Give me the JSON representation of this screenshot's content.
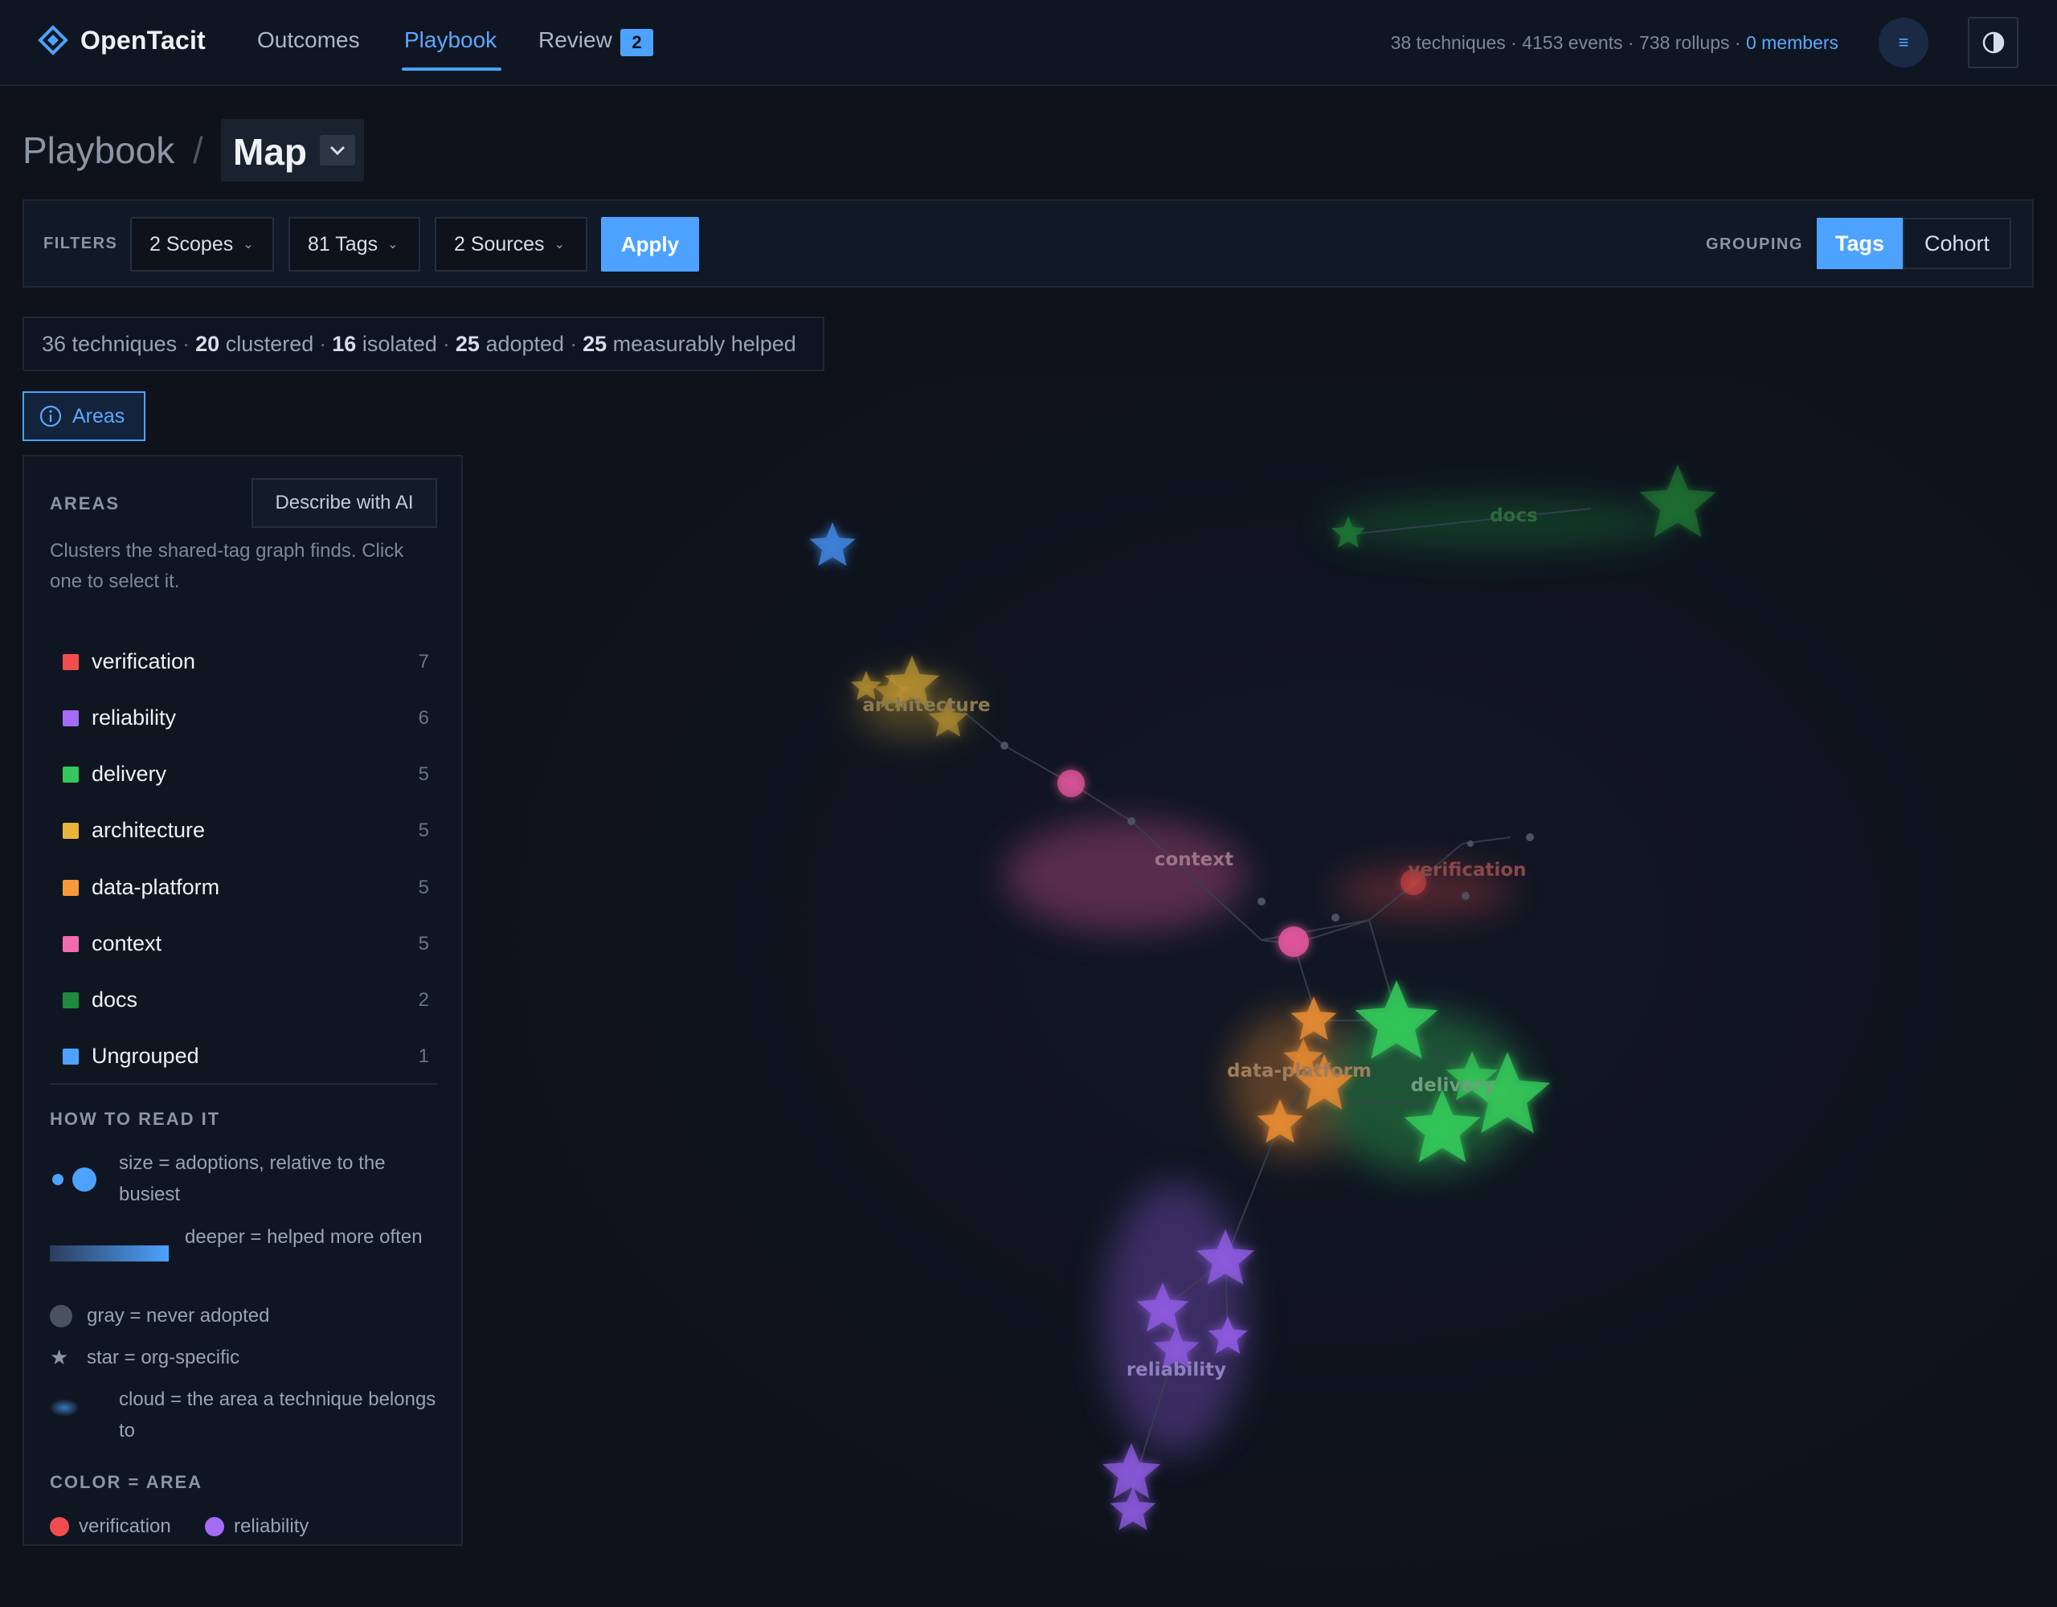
{
  "brand": {
    "name": "OpenTacit",
    "icon": "diamond-logo-icon"
  },
  "nav": {
    "outcomes": "Outcomes",
    "playbook": "Playbook",
    "review": "Review",
    "review_badge": "2"
  },
  "top_stats": {
    "summary": "38 techniques · 4153 events · 738 rollups · ",
    "members_link": "0 members",
    "menu_icon": "≡",
    "theme_icon": "contrast-icon"
  },
  "breadcrumb": {
    "root": "Playbook",
    "separator": "/",
    "current": "Map"
  },
  "filters": {
    "label": "FILTERS",
    "scopes": "2 Scopes",
    "tags": "81 Tags",
    "sources": "2 Sources",
    "apply": "Apply"
  },
  "grouping": {
    "label": "GROUPING",
    "options": [
      "Tags",
      "Cohort"
    ],
    "selected": "Tags"
  },
  "summary": {
    "techniques": "36 techniques",
    "clustered_n": "20",
    "clustered_t": "clustered",
    "isolated_n": "16",
    "isolated_t": "isolated",
    "adopted_n": "25",
    "adopted_t": "adopted",
    "helped_n": "25",
    "helped_t": "measurably helped",
    "sep": "·"
  },
  "areas_toggle": "Areas",
  "panel": {
    "title": "AREAS",
    "ai_button": "Describe with AI",
    "description": "Clusters the shared-tag graph finds. Click one to select it.",
    "areas": [
      {
        "name": "verification",
        "count": "7",
        "color": "#f04e4e"
      },
      {
        "name": "reliability",
        "count": "6",
        "color": "#a46cf5"
      },
      {
        "name": "delivery",
        "count": "5",
        "color": "#34c759"
      },
      {
        "name": "architecture",
        "count": "5",
        "color": "#e8b43a"
      },
      {
        "name": "data-platform",
        "count": "5",
        "color": "#f59a3a"
      },
      {
        "name": "context",
        "count": "5",
        "color": "#f06bb0"
      },
      {
        "name": "docs",
        "count": "2",
        "color": "#1f8a3a"
      },
      {
        "name": "Ungrouped",
        "count": "1",
        "color": "#4da2ff"
      }
    ],
    "howto_title": "HOW TO READ IT",
    "legend": {
      "size": "size = adoptions, relative to the busiest",
      "depth": "deeper = helped more often",
      "gray": "gray = never adopted",
      "star": "star = org-specific",
      "cloud": "cloud = the area a technique belongs to",
      "star_glyph": "★"
    },
    "color_title": "COLOR = AREA",
    "color_items": [
      {
        "name": "verification",
        "color": "#f04e4e"
      },
      {
        "name": "reliability",
        "color": "#a46cf5"
      }
    ]
  },
  "map": {
    "clusters": [
      {
        "name": "docs",
        "color": "#1f8a3a"
      },
      {
        "name": "architecture",
        "color": "#c9a033"
      },
      {
        "name": "context",
        "color": "#e0569e"
      },
      {
        "name": "verification",
        "color": "#d04545"
      },
      {
        "name": "data-platform",
        "color": "#e58b32"
      },
      {
        "name": "delivery",
        "color": "#34c759"
      },
      {
        "name": "reliability",
        "color": "#8d5be0"
      }
    ]
  }
}
